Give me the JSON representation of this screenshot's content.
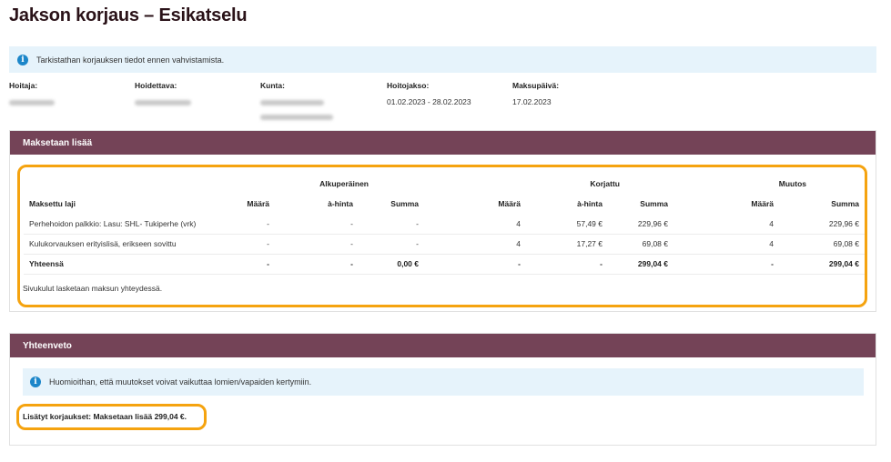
{
  "page": {
    "title": "Jakson korjaus – Esikatselu"
  },
  "top_info": {
    "icon": "info-icon",
    "text": "Tarkistathan korjauksen tiedot ennen vahvistamista."
  },
  "meta": {
    "hoitaja": {
      "label": "Hoitaja:",
      "value": ""
    },
    "hoidettava": {
      "label": "Hoidettava:",
      "value": ""
    },
    "kunta": {
      "label": "Kunta:",
      "value": ""
    },
    "hoitojakso": {
      "label": "Hoitojakso:",
      "value": "01.02.2023 - 28.02.2023"
    },
    "maksupaiva": {
      "label": "Maksupäivä:",
      "value": "17.02.2023"
    }
  },
  "section_additional": {
    "header": "Maksetaan lisää",
    "groups": {
      "original": "Alkuperäinen",
      "corrected": "Korjattu",
      "change": "Muutos"
    },
    "columns": {
      "type": "Maksettu laji",
      "qty": "Määrä",
      "unit": "à-hinta",
      "sum": "Summa"
    },
    "rows": [
      {
        "type": "Perhehoidon palkkio: Lasu: SHL- Tukiperhe (vrk)",
        "o_qty": "-",
        "o_unit": "-",
        "o_sum": "-",
        "c_qty": "4",
        "c_unit": "57,49 €",
        "c_sum": "229,96 €",
        "m_qty": "4",
        "m_sum": "229,96 €"
      },
      {
        "type": "Kulukorvauksen erityislisä, erikseen sovittu",
        "o_qty": "-",
        "o_unit": "-",
        "o_sum": "-",
        "c_qty": "4",
        "c_unit": "17,27 €",
        "c_sum": "69,08 €",
        "m_qty": "4",
        "m_sum": "69,08 €"
      }
    ],
    "total": {
      "type": "Yhteensä",
      "o_qty": "-",
      "o_unit": "-",
      "o_sum": "0,00 €",
      "c_qty": "-",
      "c_unit": "-",
      "c_sum": "299,04 €",
      "m_qty": "-",
      "m_sum": "299,04 €"
    },
    "footnote": "Sivukulut lasketaan maksun yhteydessä."
  },
  "section_summary": {
    "header": "Yhteenveto",
    "info": {
      "icon": "info-icon",
      "text": "Huomioithan, että muutokset voivat vaikuttaa lomien/vapaiden kertymiin."
    },
    "line": "Lisätyt korjaukset: Maksetaan lisää 299,04 €."
  },
  "colors": {
    "header": "#744357",
    "info_bg": "#e6f3fb",
    "info_icon": "#1c86c9",
    "highlight": "#f5a30f"
  }
}
